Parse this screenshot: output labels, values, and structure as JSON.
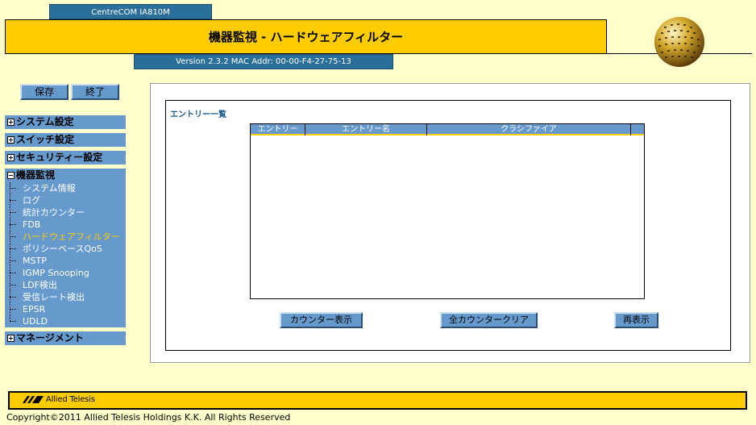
{
  "header": {
    "model": "CentreCOM IA810M",
    "title": "機器監視 - ハードウェアフィルター",
    "version": "Version 2.3.2 MAC Addr: 00-00-F4-27-75-13"
  },
  "toolbar": {
    "save_label": "保存",
    "end_label": "終了"
  },
  "menu": {
    "system": "システム設定",
    "switch": "スイッチ設定",
    "security": "セキュリティー設定",
    "monitor": "機器監視",
    "management": "マネージメント",
    "monitor_items": [
      "システム情報",
      "ログ",
      "統計カウンター",
      "FDB",
      "ハードウェアフィルター",
      "ポリシーベースQoS",
      "MSTP",
      "IGMP Snooping",
      "LDF検出",
      "受信レート検出",
      "EPSR",
      "UDLD"
    ],
    "active_index": 4
  },
  "main": {
    "section_title": "エントリー一覧",
    "columns": [
      "エントリー",
      "エントリー名",
      "クラシファイア",
      ""
    ],
    "rows": [],
    "buttons": {
      "counter": "カウンター表示",
      "clear_all": "全カウンタークリア",
      "refresh": "再表示"
    }
  },
  "footer": {
    "logo": "Allied Telesis",
    "copyright": "Copyright©2011 Allied Telesis Holdings K.K. All Rights Reserved"
  },
  "colors": {
    "accent_yellow": "#ffcc00",
    "menu_blue": "#6699cc",
    "header_blue": "#2a6e9a",
    "background": "#ffffcc"
  }
}
